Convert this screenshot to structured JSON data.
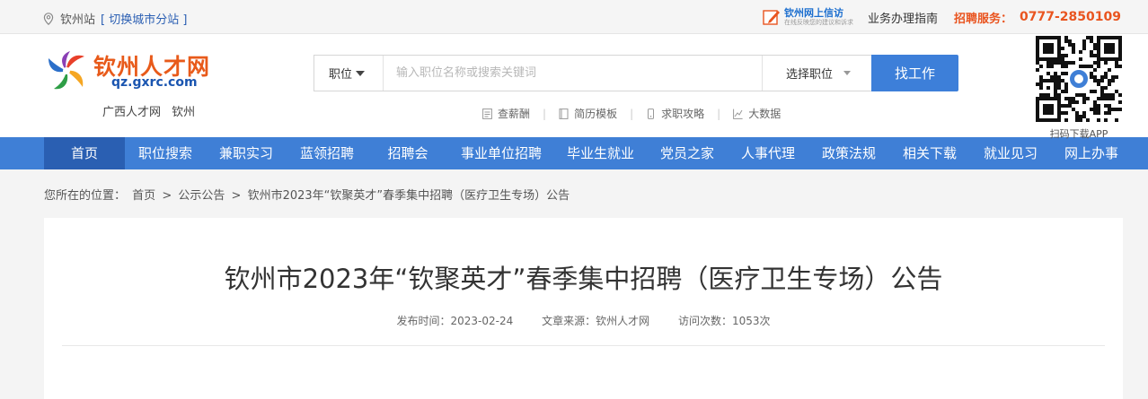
{
  "topbar": {
    "station": "钦州站",
    "switch_city": "[ 切换城市分站 ]",
    "xinfang_title": "钦州网上信访",
    "xinfang_sub": "在线反映您的建议和诉求",
    "guide": "业务办理指南",
    "hotline_label": "招聘服务：",
    "hotline": "0777-2850109"
  },
  "logo": {
    "name": "钦州人才网",
    "url": "qz.gxrc.com",
    "sub": "广西人才网 钦州"
  },
  "search": {
    "category": "职位",
    "placeholder": "输入职位名称或搜索关键词",
    "select_label": "选择职位",
    "button": "找工作"
  },
  "quick_links": [
    "查薪酬",
    "简历模板",
    "求职攻略",
    "大数据"
  ],
  "qr": {
    "caption": "扫码下载APP"
  },
  "nav": [
    "首页",
    "职位搜索",
    "兼职实习",
    "蓝领招聘",
    "招聘会",
    "事业单位招聘",
    "毕业生就业",
    "党员之家",
    "人事代理",
    "政策法规",
    "相关下载",
    "就业见习",
    "网上办事"
  ],
  "breadcrumb": {
    "label": "您所在的位置：",
    "home": "首页",
    "section": "公示公告",
    "current": "钦州市2023年“钦聚英才”春季集中招聘（医疗卫生专场）公告",
    "sep": ">"
  },
  "article": {
    "title": "钦州市2023年“钦聚英才”春季集中招聘（医疗卫生专场）公告",
    "date_label": "发布时间：",
    "date": "2023-02-24",
    "source_label": "文章来源：",
    "source": "钦州人才网",
    "views_label": "访问次数：",
    "views": "1053次"
  },
  "colors": {
    "brand_blue": "#3f7fd6",
    "nav_active": "#2a5fb2",
    "accent_orange": "#e9541f"
  }
}
